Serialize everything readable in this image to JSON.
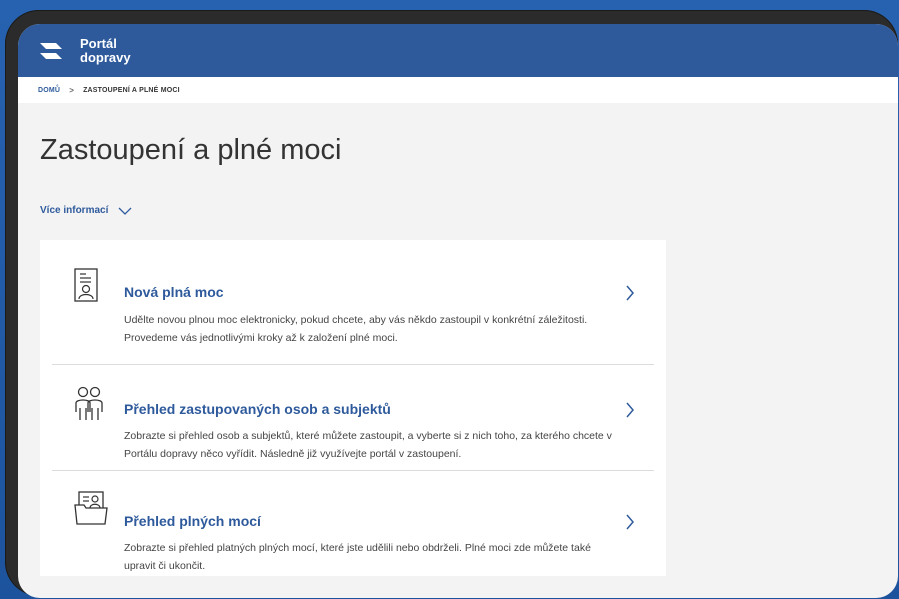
{
  "header": {
    "logo_line1": "Portál",
    "logo_line2": "dopravy"
  },
  "breadcrumb": {
    "home": "DOMŮ",
    "separator": ">",
    "current": "ZASTOUPENÍ A PLNÉ MOCI"
  },
  "page": {
    "title": "Zastoupení a plné moci",
    "more_info": "Více informací"
  },
  "items": [
    {
      "icon": "id-card-icon",
      "title": "Nová plná moc",
      "description": "Udělte novou plnou moc elektronicky, pokud chcete, aby vás někdo zastoupil v konkrétní záležitosti. Provedeme vás jednotlivými kroky až k založení plné moci."
    },
    {
      "icon": "people-icon",
      "title": "Přehled zastupovaných osob a subjektů",
      "description": "Zobrazte si přehled osob a subjektů, které můžete zastoupit, a vyberte si z nich toho, za kterého chcete v Portálu dopravy něco vyřídit. Následně již využívejte portál v zastoupení."
    },
    {
      "icon": "folder-card-icon",
      "title": "Přehled plných mocí",
      "description": "Zobrazte si přehled platných plných mocí, které jste udělili nebo obdrželi. Plné moci zde můžete také upravit či ukončit."
    }
  ],
  "colors": {
    "brand": "#2e5a9c",
    "background": "#1f5aa6",
    "device_frame": "#2b2b2b"
  }
}
